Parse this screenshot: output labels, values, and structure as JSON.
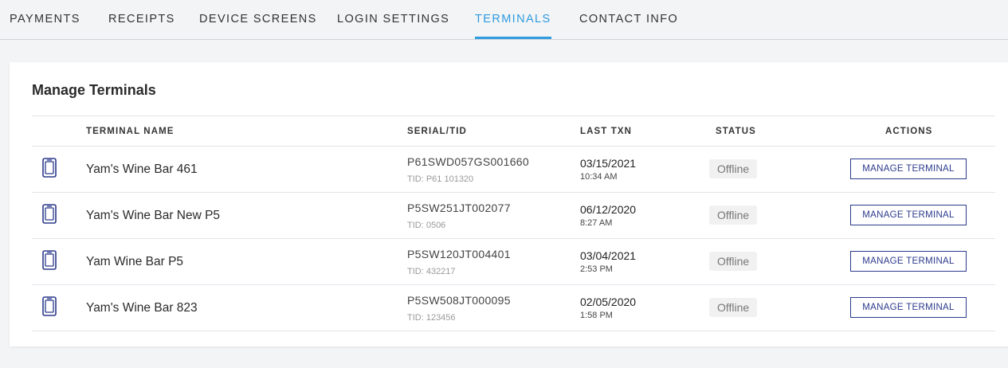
{
  "tabs": [
    {
      "label": "PAYMENTS"
    },
    {
      "label": "RECEIPTS"
    },
    {
      "label": "DEVICE SCREENS"
    },
    {
      "label": "LOGIN SETTINGS"
    },
    {
      "label": "TERMINALS",
      "active": true
    },
    {
      "label": "CONTACT INFO"
    }
  ],
  "card": {
    "title": "Manage Terminals",
    "columns": {
      "name": "TERMINAL NAME",
      "serial": "SERIAL/TID",
      "last_txn": "LAST TXN",
      "status": "STATUS",
      "actions": "ACTIONS"
    },
    "rows": [
      {
        "icon": "terminal-device-icon",
        "name": "Yam's Wine Bar 461",
        "serial": "P61SWD057GS001660",
        "tid": "TID: P61 101320",
        "date": "03/15/2021",
        "time": "10:34 AM",
        "status": "Offline",
        "action": "MANAGE TERMINAL"
      },
      {
        "icon": "terminal-device-icon",
        "name": "Yam's Wine Bar New P5",
        "serial": "P5SW251JT002077",
        "tid": "TID: 0506",
        "date": "06/12/2020",
        "time": "8:27 AM",
        "status": "Offline",
        "action": "MANAGE TERMINAL"
      },
      {
        "icon": "terminal-device-icon",
        "name": "Yam Wine Bar P5",
        "serial": "P5SW120JT004401",
        "tid": "TID: 432217",
        "date": "03/04/2021",
        "time": "2:53 PM",
        "status": "Offline",
        "action": "MANAGE TERMINAL"
      },
      {
        "icon": "terminal-device-icon",
        "name": "Yam's Wine Bar 823",
        "serial": "P5SW508JT000095",
        "tid": "TID: 123456",
        "date": "02/05/2020",
        "time": "1:58 PM",
        "status": "Offline",
        "action": "MANAGE TERMINAL"
      }
    ]
  },
  "colors": {
    "active_tab": "#2e9be0",
    "icon_and_button": "#2b3a8c",
    "status_bg": "#f1f1f1",
    "page_bg": "#f3f4f6"
  }
}
